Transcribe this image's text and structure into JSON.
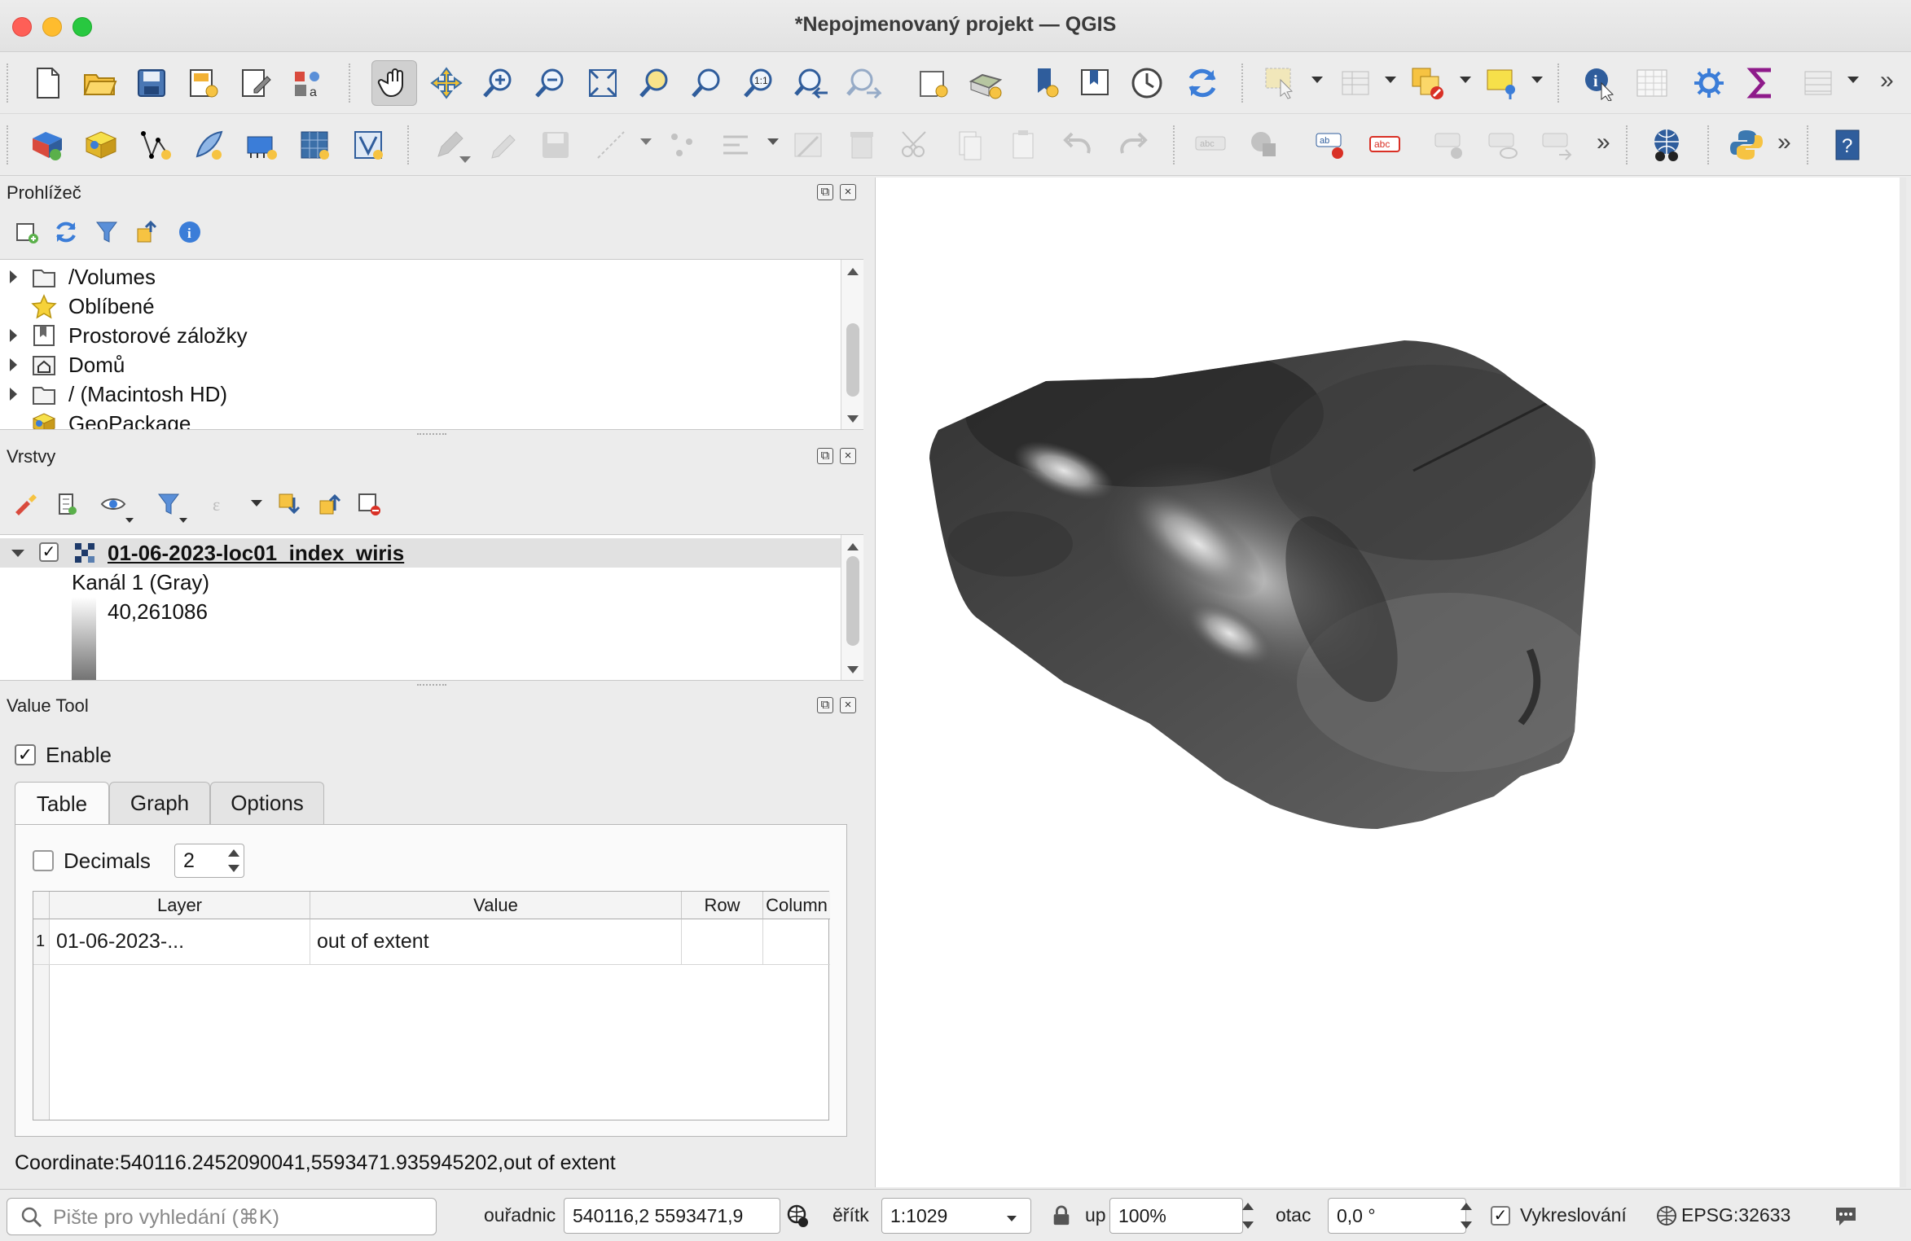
{
  "window": {
    "title": "*Nepojmenovaný projekt — QGIS"
  },
  "toolbar1": {
    "icons": [
      "new-project-icon",
      "open-project-icon",
      "save-project-icon",
      "new-print-layout-icon",
      "layout-manager-icon",
      "style-manager-icon",
      "pan-map-icon",
      "pan-to-selection-icon",
      "zoom-in-icon",
      "zoom-out-icon",
      "zoom-full-icon",
      "zoom-to-selection-icon",
      "zoom-to-layer-icon",
      "zoom-native-icon",
      "zoom-last-icon",
      "zoom-next-icon",
      "new-map-view-icon",
      "new-3d-view-icon",
      "new-bookmark-icon",
      "show-bookmarks-icon",
      "temporal-controller-icon",
      "refresh-icon",
      "select-features-icon",
      "attribute-table-icon",
      "deselect-icon",
      "annotation-icon",
      "identify-icon",
      "measure-icon",
      "processing-toolbox-icon",
      "statistics-icon",
      "show-attribute-table-icon"
    ]
  },
  "toolbar2": {
    "icons": [
      "data-source-manager-icon",
      "new-geopackage-layer-icon",
      "vector-digitize-icon",
      "new-spatialite-icon",
      "temporary-layer-icon",
      "raster-icon",
      "virtual-layer-icon",
      "toggle-editing-icon",
      "edit-pencil-icon",
      "save-edits-icon",
      "digitize-line-icon",
      "vertex-tool-icon",
      "modify-attributes-icon",
      "delete-selected-icon",
      "cut-features-icon",
      "copy-features-icon",
      "paste-features-icon",
      "undo-icon",
      "redo-icon",
      "label-tool-icon",
      "diagram-tool-icon",
      "label-pin-icon",
      "label-highlight-icon",
      "label-show-hide-icon",
      "label-move-icon",
      "label-rotate-icon",
      "globe-icon",
      "python-console-icon",
      "help-icon"
    ]
  },
  "browser": {
    "title": "Prohlížeč",
    "items": [
      {
        "label": "/Volumes",
        "expandable": true,
        "icon": "folder-icon"
      },
      {
        "label": "Oblíbené",
        "expandable": false,
        "icon": "favorites-star-icon"
      },
      {
        "label": "Prostorové záložky",
        "expandable": true,
        "icon": "spatial-bookmarks-icon"
      },
      {
        "label": "Domů",
        "expandable": true,
        "icon": "home-folder-icon"
      },
      {
        "label": "/ (Macintosh HD)",
        "expandable": true,
        "icon": "drive-folder-icon"
      },
      {
        "label": "GeoPackage",
        "expandable": false,
        "icon": "geopackage-icon"
      }
    ]
  },
  "layers": {
    "title": "Vrstvy",
    "layer_name": "01-06-2023-loc01_index_wiris",
    "band_label": "Kanál 1 (Gray)",
    "legend_max": "40,261086"
  },
  "value_tool": {
    "title": "Value Tool",
    "enable_label": "Enable",
    "tabs": [
      "Table",
      "Graph",
      "Options"
    ],
    "decimals_label": "Decimals",
    "decimals_value": "2",
    "columns": [
      "Layer",
      "Value",
      "Row",
      "Column"
    ],
    "rows": [
      {
        "index": "1",
        "layer": "01-06-2023-...",
        "value": "out of extent",
        "row": "",
        "column": ""
      }
    ],
    "coordinate_text": "Coordinate:540116.2452090041,5593471.935945202,out of extent"
  },
  "statusbar": {
    "search_placeholder": "Pište pro vyhledání (⌘K)",
    "coordinate_label": "ouřadnic",
    "coordinate_value": "540116,2  5593471,9",
    "scale_label": "ěřítk",
    "scale_value": "1:1029",
    "magnifier_label": "up",
    "magnifier_value": "100%",
    "rotation_label": "otac",
    "rotation_value": "0,0 °",
    "render_label": "Vykreslování",
    "crs_label": "EPSG:32633"
  }
}
